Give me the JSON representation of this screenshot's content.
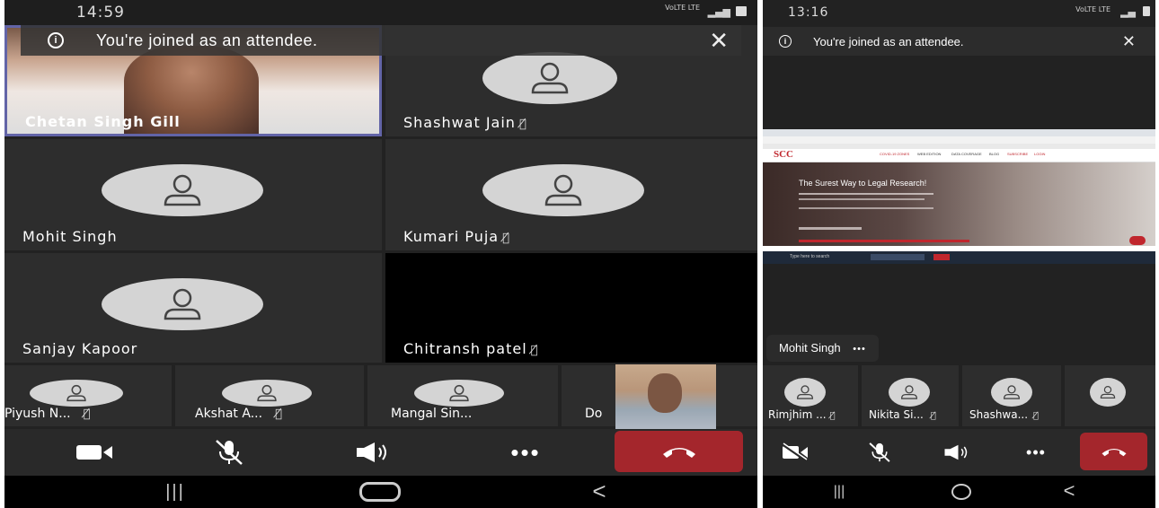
{
  "left": {
    "status": {
      "time": "14:59",
      "network": "VoLTE LTE",
      "icons": "📷 ✆ ⋯"
    },
    "banner": {
      "text": "You're joined as an attendee.",
      "close": "✕",
      "info": "i"
    },
    "participants": [
      {
        "name": "Chetan Singh Gill",
        "video": true,
        "muted": false
      },
      {
        "name": "Shashwat Jain",
        "video": false,
        "muted": true
      },
      {
        "name": "Mohit Singh",
        "video": false,
        "muted": false
      },
      {
        "name": "Kumari Puja",
        "video": false,
        "muted": true
      },
      {
        "name": "Sanjay Kapoor",
        "video": false,
        "muted": false
      },
      {
        "name": "Chitransh patel",
        "video": false,
        "muted": true
      }
    ],
    "strip": [
      {
        "name": "Piyush N...",
        "muted": true
      },
      {
        "name": "Akshat A...",
        "muted": true
      },
      {
        "name": "Mangal Sin...",
        "muted": false
      },
      {
        "name": "Do",
        "muted": false
      }
    ],
    "controls": [
      "camera-on",
      "mic-off",
      "speaker",
      "more",
      "hang-up"
    ]
  },
  "right": {
    "status": {
      "time": "13:16",
      "network": "VoLTE LTE",
      "icons": "📷 ◯ ⋯"
    },
    "banner": {
      "text": "You're joined as an attendee.",
      "close": "✕",
      "info": "i"
    },
    "shared_screen": {
      "logo": "SCC",
      "logo_sub": "ONLINE",
      "headline": "The Surest Way to Legal Research!",
      "nav": [
        "COVID-19 ZONES",
        "WEB EDITION",
        "DATA COVERAGE",
        "BLOG",
        "SUBSCRIBE",
        "LOGIN"
      ],
      "search_placeholder": "Type here to search"
    },
    "presenter": {
      "name": "Mohit Singh",
      "more": "•••"
    },
    "strip": [
      {
        "name": "Rimjhim ...",
        "muted": true
      },
      {
        "name": "Nikita Si...",
        "muted": true
      },
      {
        "name": "Shashwa...",
        "muted": true
      },
      {
        "name": "",
        "muted": false
      }
    ],
    "controls": [
      "camera-off",
      "mic-off",
      "speaker",
      "more",
      "hang-up"
    ]
  },
  "colors": {
    "hangup": "#a4262c",
    "tile": "#2d2d2d",
    "background": "#222222",
    "avatar": "#d4d4d4"
  },
  "nav": {
    "recents": "|||",
    "home": "◯",
    "back": "<"
  }
}
